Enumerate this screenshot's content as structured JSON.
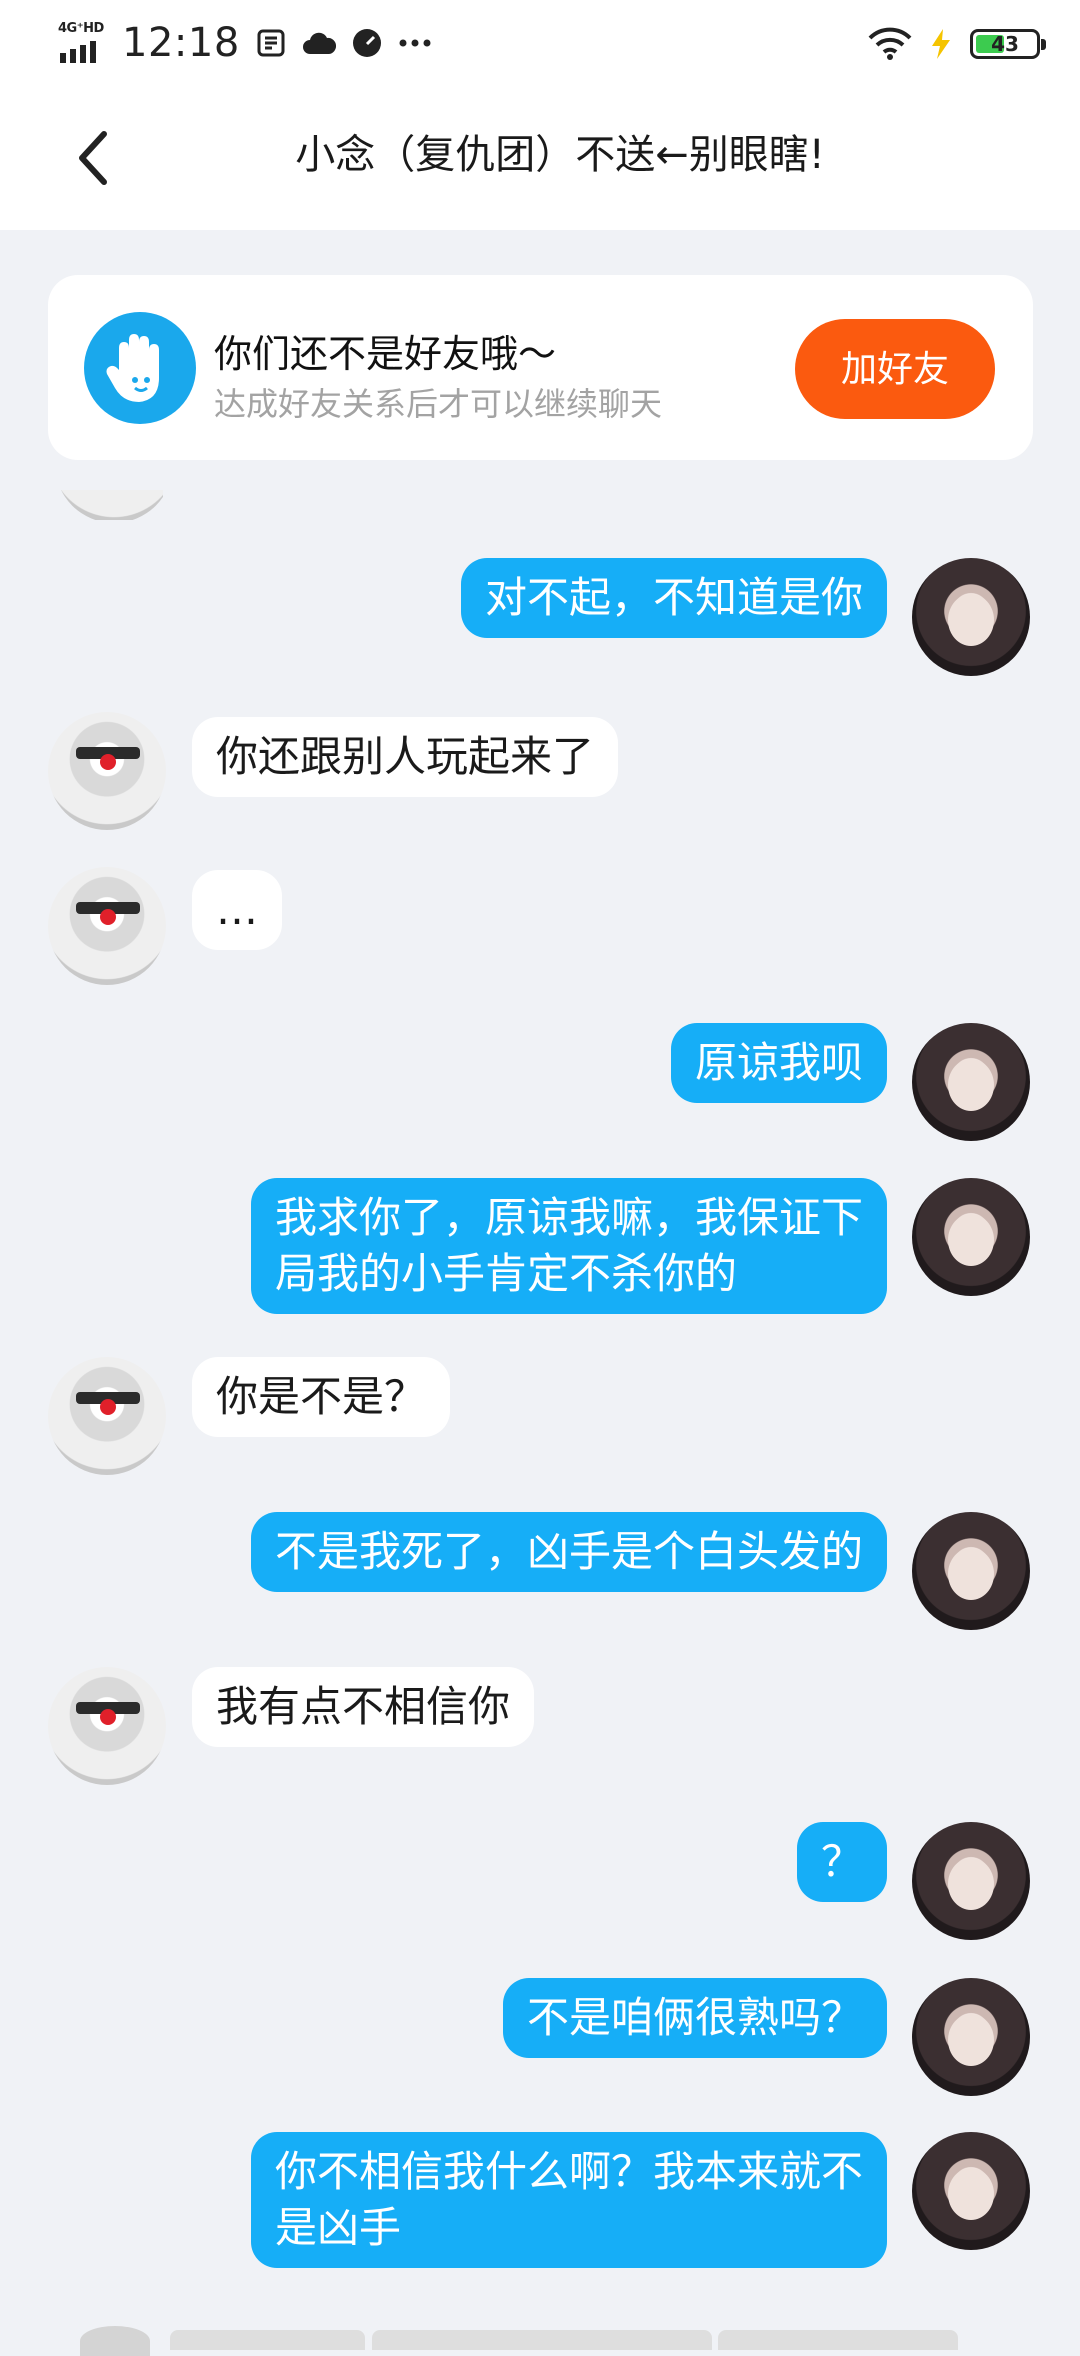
{
  "status_bar": {
    "network": "4G⁺HD",
    "time": "12:18",
    "battery": "43"
  },
  "header": {
    "title": "小念（复仇团）不送←别眼瞎!"
  },
  "friend_banner": {
    "title": "你们还不是好友哦～",
    "subtitle": "达成好友关系后才可以继续聊天",
    "button": "加好友"
  },
  "messages": [
    {
      "side": "me",
      "text": "对不起，不知道是你"
    },
    {
      "side": "other",
      "text": "你还跟别人玩起来了"
    },
    {
      "side": "other",
      "text": "…"
    },
    {
      "side": "me",
      "text": "原谅我呗"
    },
    {
      "side": "me",
      "line1": "我求你了，原谅我嘛，我保证下",
      "line2": "局我的小手肯定不杀你的"
    },
    {
      "side": "other",
      "text": "你是不是？"
    },
    {
      "side": "me",
      "text": "不是我死了，凶手是个白头发的"
    },
    {
      "side": "other",
      "text": "我有点不相信你"
    },
    {
      "side": "me",
      "text": "？"
    },
    {
      "side": "me",
      "text": "不是咱俩很熟吗？"
    },
    {
      "side": "me",
      "line1": "你不相信我什么啊？我本来就不",
      "line2": "是凶手"
    }
  ]
}
